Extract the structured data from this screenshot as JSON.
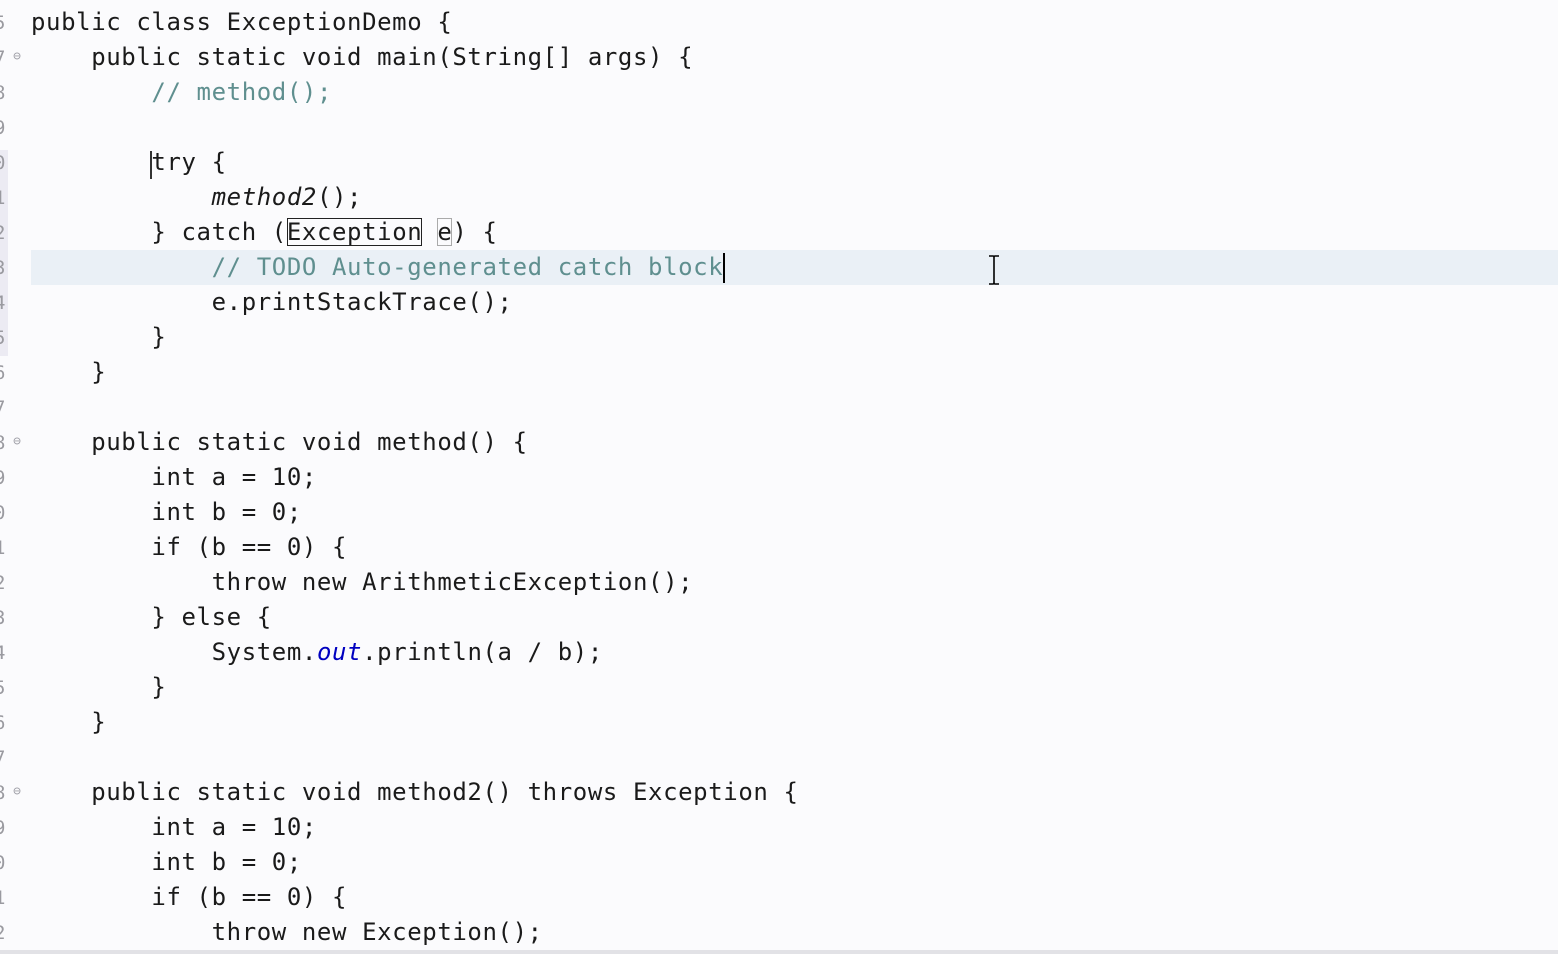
{
  "editor": {
    "line_numbers": [
      "5",
      "7",
      "8",
      "9",
      "0",
      "1",
      "2",
      "3",
      "4",
      "5",
      "6",
      "7",
      "8",
      "9",
      "0",
      "1",
      "2",
      "3",
      "4",
      "5",
      "6",
      "7",
      "8",
      "9",
      "0",
      "1",
      "2"
    ],
    "fold_lines": [
      1,
      12,
      22
    ],
    "current_line_index": 7,
    "tokens": {
      "l0": {
        "a": "public class ExceptionDemo {"
      },
      "l1": {
        "a": "    public static void main(String[] args) {"
      },
      "l2": {
        "indent": "        ",
        "comment": "// method();"
      },
      "l3": {
        "a": ""
      },
      "l4": {
        "indent": "        ",
        "kw": "try",
        "rest": " {"
      },
      "l5": {
        "indent": "            ",
        "call": "method2",
        "rest": "();"
      },
      "l6": {
        "pre": "        } catch (",
        "type": "Exception",
        "sp": " ",
        "var": "e",
        "post": ") {"
      },
      "l7": {
        "indent": "            ",
        "comment": "// TODO Auto-generated catch block"
      },
      "l8": {
        "a": "            e.printStackTrace();"
      },
      "l9": {
        "a": "        }"
      },
      "l10": {
        "a": "    }"
      },
      "l11": {
        "a": ""
      },
      "l12": {
        "a": "    public static void method() {"
      },
      "l13": {
        "a": "        int a = 10;"
      },
      "l14": {
        "a": "        int b = 0;"
      },
      "l15": {
        "a": "        if (b == 0) {"
      },
      "l16": {
        "a": "            throw new ArithmeticException();"
      },
      "l17": {
        "a": "        } else {"
      },
      "l18": {
        "pre": "            System.",
        "field": "out",
        "post": ".println(a / b);"
      },
      "l19": {
        "a": "        }"
      },
      "l20": {
        "a": "    }"
      },
      "l21": {
        "a": ""
      },
      "l22": {
        "a": "    public static void method2() throws Exception {"
      },
      "l23": {
        "a": "        int a = 10;"
      },
      "l24": {
        "a": "        int b = 0;"
      },
      "l25": {
        "a": "        if (b == 0) {"
      },
      "l26": {
        "a": "            throw new Exception();"
      }
    },
    "fold_icon": "fold-collapse-icon",
    "cursor_icon": "i-beam-cursor-icon"
  }
}
